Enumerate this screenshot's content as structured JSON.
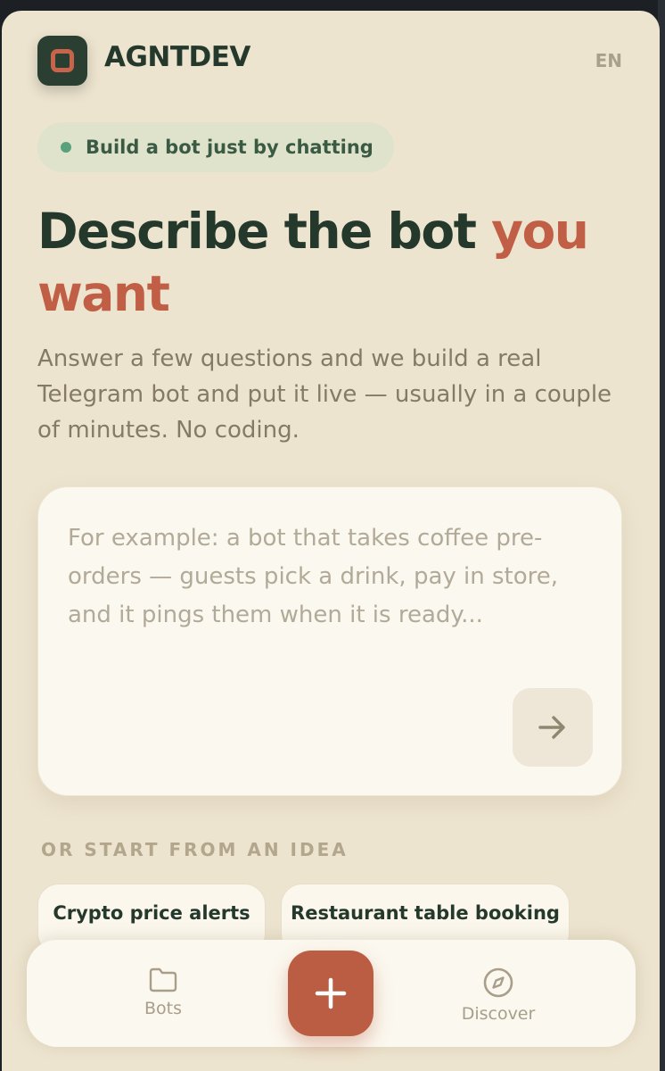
{
  "header": {
    "brand": "AGNTDEV",
    "lang": "EN",
    "logo_icon": "app-logo-icon"
  },
  "badge": {
    "text": "Build a bot just by chatting",
    "dot_color": "#5aa07a"
  },
  "hero": {
    "title_part1": "Describe the bot ",
    "title_accent": "you want",
    "accent_color": "#c05f45",
    "subtitle": "Answer a few questions and we build a real Telegram bot and put it live — usually in a couple of minutes. No coding."
  },
  "prompt": {
    "value": "",
    "placeholder": "For example: a bot that takes coffee pre-orders — guests pick a drink, pay in store, and it pings them when it is ready...",
    "send_icon": "arrow-right-icon"
  },
  "ideas": {
    "label": "OR START FROM AN IDEA",
    "chips": [
      {
        "label": "Crypto price alerts"
      },
      {
        "label": "Restaurant table booking"
      }
    ]
  },
  "nav": {
    "items": [
      {
        "label": "Bots",
        "icon": "folder-icon"
      },
      {
        "label": "Discover",
        "icon": "compass-icon"
      }
    ],
    "fab_icon": "plus-icon",
    "fab_color": "#bb5d43"
  }
}
